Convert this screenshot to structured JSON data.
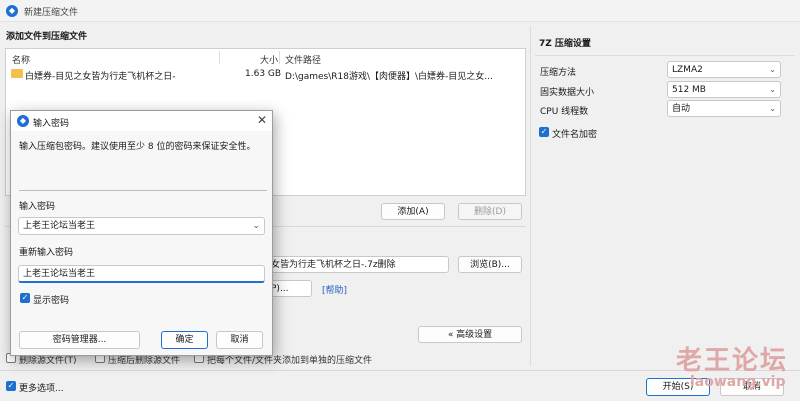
{
  "window": {
    "title": "新建压缩文件"
  },
  "files_section": {
    "title": "添加文件到压缩文件",
    "columns": {
      "name": "名称",
      "size": "大小",
      "path": "文件路径"
    },
    "rows": [
      {
        "name": "白嫖券-目见之女皆为行走飞机杯之日-",
        "size": "1.63 GB",
        "path": "D:\\games\\R18游戏\\【肉便器】\\白嫖券-目见之女..."
      }
    ],
    "add_label": "添加(A)",
    "remove_label": "删除(D)"
  },
  "archive": {
    "filename_value": "女皆为行走飞机杯之日-.7z删除",
    "browse_label": "浏览(B)...",
    "settings_value": "P)...",
    "help_label": "[帮助]",
    "advanced_label": "« 高级设置"
  },
  "bottom_options": {
    "partial_left": "删除源文件(T)",
    "partial_mid": "压缩后删除源文件",
    "partial_right": "把每个文件/文件夹添加到单独的压缩文件",
    "more_options_label": "更多选项...",
    "start_label": "开始(S)",
    "cancel_label": "取消"
  },
  "seven_z": {
    "title": "7Z 压缩设置",
    "method_label": "压缩方法",
    "method_value": "LZMA2",
    "dict_label": "固实数据大小",
    "dict_value": "512 MB",
    "threads_label": "CPU 线程数",
    "threads_value": "自动",
    "encrypt_names_label": "文件名加密"
  },
  "dialog": {
    "title": "输入密码",
    "description": "输入压缩包密码。建议使用至少 8 位的密码来保证安全性。",
    "password_label": "输入密码",
    "password_value": "上老王论坛当老王",
    "confirm_label": "重新输入密码",
    "confirm_value": "上老王论坛当老王",
    "show_password_label": "显示密码",
    "manager_label": "密码管理器...",
    "ok_label": "确定",
    "cancel_label": "取消"
  },
  "watermark": {
    "line1": "老王论坛",
    "line2": "laowang.vip"
  },
  "colors": {
    "accent": "#1f6fd0",
    "watermark": "#e0a7a7"
  }
}
